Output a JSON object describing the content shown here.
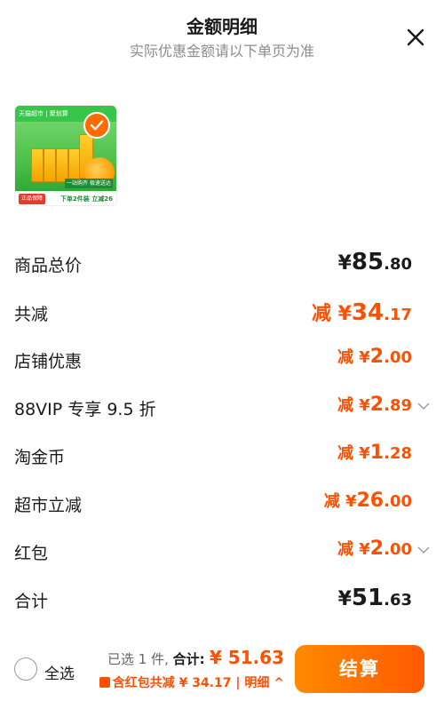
{
  "header": {
    "title": "金额明细",
    "subtitle": "实际优惠金额请以下单页为准"
  },
  "product": {
    "banner_text": "天猫超市 | 聚划算",
    "tag": "正品保障",
    "promo_a": "一站购齐 极速送达",
    "promo_b": "下单2件装 立减26元"
  },
  "rows": [
    {
      "label": "商品总价",
      "prefix": "¥",
      "int": "85",
      "dec": ".80"
    },
    {
      "label": "共减",
      "prefix": "减 ¥",
      "int": "34",
      "dec": ".17"
    },
    {
      "label": "店铺优惠",
      "prefix": "减 ¥",
      "int": "2",
      "dec": ".00"
    },
    {
      "label": "88VIP 专享 9.5 折",
      "prefix": "减 ¥",
      "int": "2",
      "dec": ".89"
    },
    {
      "label": "淘金币",
      "prefix": "减 ¥",
      "int": "1",
      "dec": ".28"
    },
    {
      "label": "超市立减",
      "prefix": "减 ¥",
      "int": "26",
      "dec": ".00"
    },
    {
      "label": "红包",
      "prefix": "减 ¥",
      "int": "2",
      "dec": ".00"
    },
    {
      "label": "合计",
      "prefix": "¥",
      "int": "51",
      "dec": ".63"
    }
  ],
  "footer": {
    "select_all": "全选",
    "selected_count": "已选 1 件, ",
    "total_label": "合计: ",
    "total_value": "¥ 51.63",
    "discount_text": "含红包共减 ¥ 34.17 | ",
    "detail_link": "明细 ^",
    "checkout_label": "结算"
  },
  "colors": {
    "accent": "#ff5000",
    "checkout_gradient_start": "#ff8a00",
    "checkout_gradient_end": "#ff5a00"
  }
}
